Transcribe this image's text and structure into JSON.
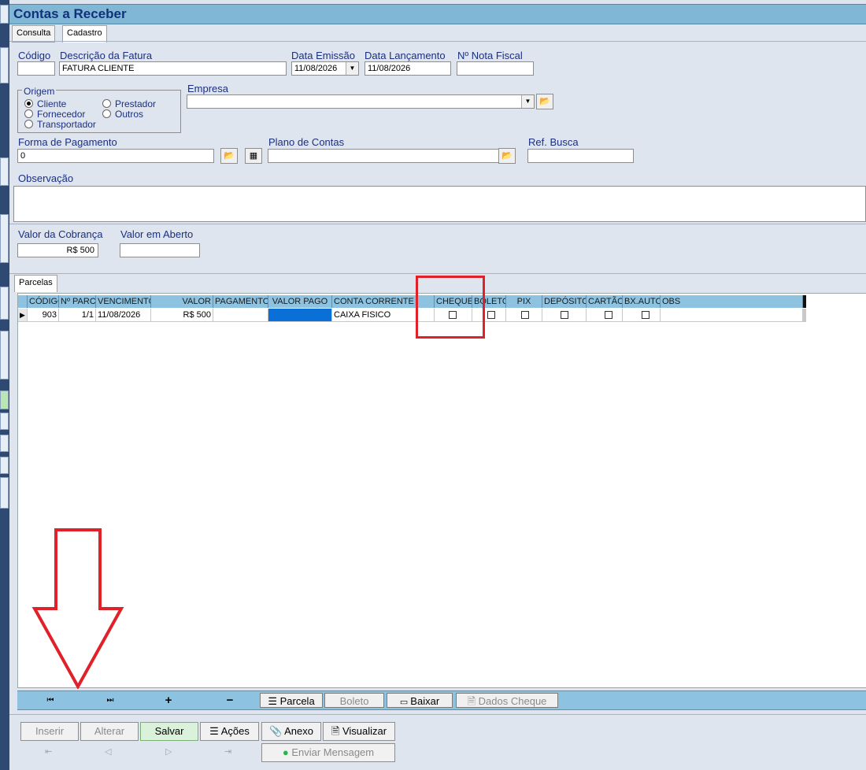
{
  "window": {
    "title": "Contas a Receber"
  },
  "tabs": [
    {
      "label": "Consulta"
    },
    {
      "label": "Cadastro"
    }
  ],
  "form": {
    "codigo": {
      "label": "Código",
      "value": ""
    },
    "descricao": {
      "label": "Descrição da Fatura",
      "value": "FATURA CLIENTE"
    },
    "data_emissao": {
      "label": "Data Emissão",
      "value": "11/08/2026"
    },
    "data_lancamento": {
      "label": "Data Lançamento",
      "value": "11/08/2026"
    },
    "nota_fiscal": {
      "label": "Nº Nota Fiscal",
      "value": ""
    },
    "origem": {
      "label": "Origem",
      "options": [
        "Cliente",
        "Prestador",
        "Fornecedor",
        "Outros",
        "Transportador"
      ],
      "selected": "Cliente"
    },
    "empresa": {
      "label": "Empresa",
      "value": ""
    },
    "forma_pagamento": {
      "label": "Forma de Pagamento",
      "value": "0"
    },
    "plano_contas": {
      "label": "Plano de Contas",
      "value": ""
    },
    "ref_busca": {
      "label": "Ref. Busca",
      "value": ""
    },
    "observacao": {
      "label": "Observação",
      "value": ""
    },
    "valor_cobranca": {
      "label": "Valor da Cobrança",
      "value": "R$ 500"
    },
    "valor_aberto": {
      "label": "Valor em Aberto",
      "value": ""
    }
  },
  "parcelas": {
    "tab_label": "Parcelas",
    "columns": [
      "CÓDIGO",
      "Nº PARC",
      "VENCIMENTO",
      "VALOR",
      "PAGAMENTO",
      "VALOR PAGO",
      "CONTA CORRENTE",
      "CHEQUE",
      "BOLETO",
      "PIX",
      "DEPÓSITO",
      "CARTÃO",
      "BX.AUTO",
      "OBS"
    ],
    "rows": [
      {
        "codigo": "903",
        "parcela": "1/1",
        "vencimento": "11/08/2026",
        "valor": "R$ 500",
        "pagamento": "",
        "valor_pago": "",
        "conta_corrente": "CAIXA FISICO",
        "obs": ""
      }
    ]
  },
  "grid_toolbar": {
    "first": "⏮",
    "last": "⏭",
    "add": "+",
    "remove": "−",
    "parcela": "Parcela",
    "boleto": "Boleto",
    "baixar": "Baixar",
    "dados_cheque": "Dados Cheque"
  },
  "actions": {
    "inserir": "Inserir",
    "alterar": "Alterar",
    "salvar": "Salvar",
    "acoes": "Ações",
    "anexo": "Anexo",
    "visualizar": "Visualizar",
    "enviar_mensagem": "Enviar Mensagem"
  },
  "colors": {
    "accent": "#8dc3e0",
    "title": "#13307a",
    "highlight": "#e0212a",
    "selection": "#0a6fd6"
  }
}
